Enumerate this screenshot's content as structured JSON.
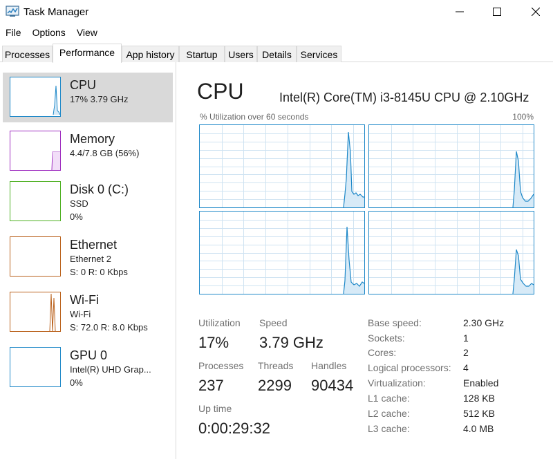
{
  "window": {
    "title": "Task Manager"
  },
  "menu": [
    "File",
    "Options",
    "View"
  ],
  "tabs": [
    "Processes",
    "Performance",
    "App history",
    "Startup",
    "Users",
    "Details",
    "Services"
  ],
  "sidebar": {
    "items": [
      {
        "name": "CPU",
        "line1": "17%  3.79 GHz",
        "line2": "",
        "color": "#1e88c8"
      },
      {
        "name": "Memory",
        "line1": "4.4/7.8 GB (56%)",
        "line2": "",
        "color": "#9e2bbf"
      },
      {
        "name": "Disk 0 (C:)",
        "line1": "SSD",
        "line2": "0%",
        "color": "#4caf1f"
      },
      {
        "name": "Ethernet",
        "line1": "Ethernet 2",
        "line2": "S: 0  R: 0 Kbps",
        "color": "#b9601a"
      },
      {
        "name": "Wi-Fi",
        "line1": "Wi-Fi",
        "line2": "S: 72.0  R: 8.0 Kbps",
        "color": "#b9601a"
      },
      {
        "name": "GPU 0",
        "line1": "Intel(R) UHD Grap...",
        "line2": "0%",
        "color": "#1e88c8"
      }
    ]
  },
  "main": {
    "title": "CPU",
    "model": "Intel(R) Core(TM) i3-8145U CPU @ 2.10GHz",
    "graph_label": "% Utilization over 60 seconds",
    "graph_max": "100%",
    "stats": {
      "utilization_label": "Utilization",
      "utilization": "17%",
      "speed_label": "Speed",
      "speed": "3.79 GHz",
      "processes_label": "Processes",
      "processes": "237",
      "threads_label": "Threads",
      "threads": "2299",
      "handles_label": "Handles",
      "handles": "90434",
      "uptime_label": "Up time",
      "uptime": "0:00:29:32"
    },
    "specs": [
      {
        "label": "Base speed:",
        "value": "2.30 GHz"
      },
      {
        "label": "Sockets:",
        "value": "1"
      },
      {
        "label": "Cores:",
        "value": "2"
      },
      {
        "label": "Logical processors:",
        "value": "4"
      },
      {
        "label": "Virtualization:",
        "value": "Enabled"
      },
      {
        "label": "L1 cache:",
        "value": "128 KB"
      },
      {
        "label": "L2 cache:",
        "value": "512 KB"
      },
      {
        "label": "L3 cache:",
        "value": "4.0 MB"
      }
    ]
  },
  "colors": {
    "cpu": "#1e88c8",
    "grid": "#cfe3f2",
    "selected_bg": "#d9d9d9"
  }
}
